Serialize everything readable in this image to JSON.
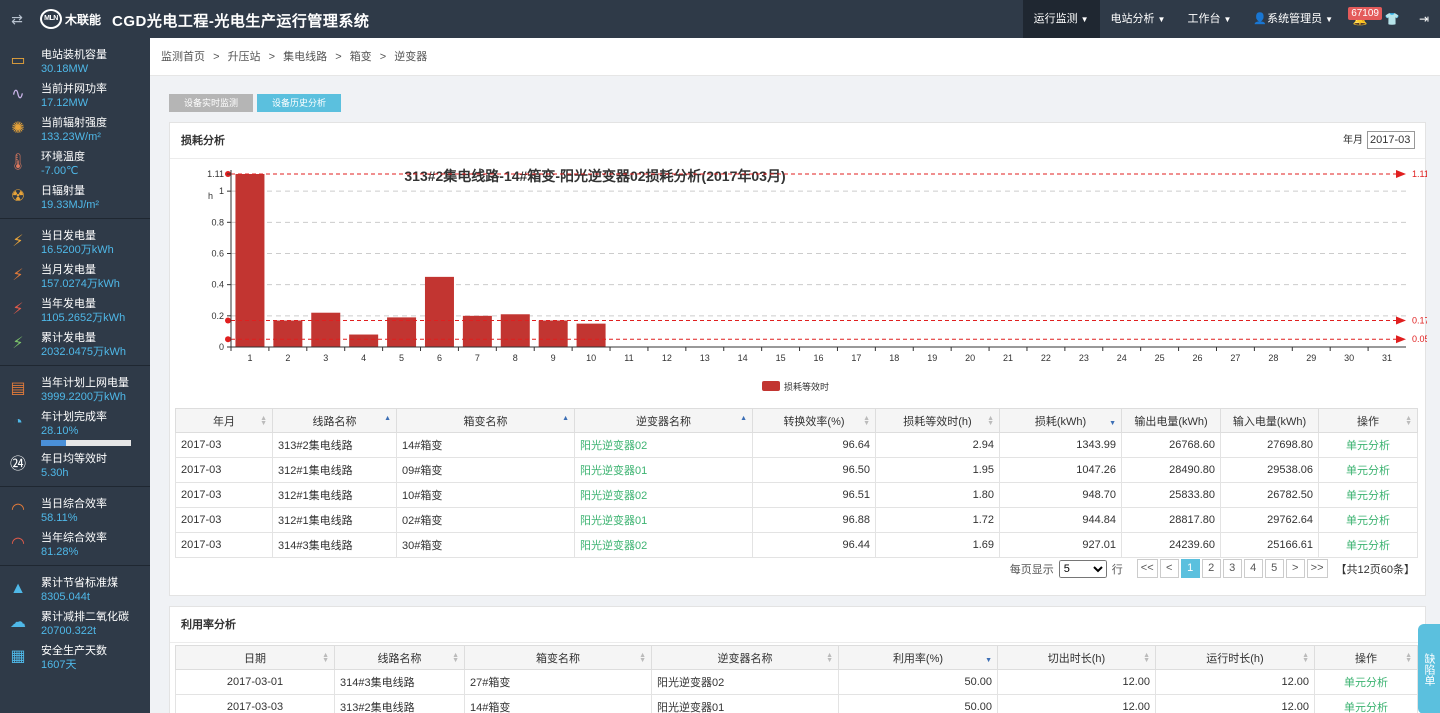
{
  "header": {
    "title": "CGD光电工程-光电生产运行管理系统",
    "logo_mark": "MLN",
    "logo_text": "木联能",
    "nav": [
      {
        "label": "运行监测"
      },
      {
        "label": "电站分析"
      },
      {
        "label": "工作台"
      },
      {
        "label": "系统管理员"
      }
    ],
    "badge": "67109"
  },
  "sidebar": {
    "group1": [
      {
        "label": "电站装机容量",
        "value": "30.18MW",
        "icon": "battery-icon"
      },
      {
        "label": "当前并网功率",
        "value": "17.12MW",
        "icon": "pulse-icon"
      },
      {
        "label": "当前辐射强度",
        "value": "133.23W/m²",
        "icon": "sun-icon"
      },
      {
        "label": "环境温度",
        "value": "-7.00℃",
        "icon": "thermometer-icon"
      },
      {
        "label": "日辐射量",
        "value": "19.33MJ/m²",
        "icon": "radiation-icon"
      }
    ],
    "group2": [
      {
        "label": "当日发电量",
        "value": "16.5200万kWh"
      },
      {
        "label": "当月发电量",
        "value": "157.0274万kWh"
      },
      {
        "label": "当年发电量",
        "value": "1105.2652万kWh"
      },
      {
        "label": "累计发电量",
        "value": "2032.0475万kWh"
      }
    ],
    "group3": [
      {
        "label": "当年计划上网电量",
        "value": "3999.2200万kWh"
      },
      {
        "label": "年计划完成率",
        "value": "28.10%",
        "progress": 0.281
      },
      {
        "label": "年日均等效时",
        "value": "5.30h"
      }
    ],
    "group4": [
      {
        "label": "当日综合效率",
        "value": "58.11%"
      },
      {
        "label": "当年综合效率",
        "value": "81.28%"
      }
    ],
    "group5": [
      {
        "label": "累计节省标准煤",
        "value": "8305.044t"
      },
      {
        "label": "累计减排二氧化碳",
        "value": "20700.322t"
      },
      {
        "label": "安全生产天数",
        "value": "1607天"
      }
    ]
  },
  "breadcrumb": [
    "监测首页",
    ">",
    "升压站",
    ">",
    "集电线路",
    ">",
    "箱变",
    ">",
    "逆变器"
  ],
  "tabs": {
    "realtime": "设备实时监测",
    "history": "设备历史分析"
  },
  "loss_panel": {
    "title": "损耗分析",
    "month_label": "年月",
    "month_value": "2017-03"
  },
  "chart_data": {
    "type": "bar",
    "title": "313#2集电线路-14#箱变-阳光逆变器02损耗分析(2017年03月)",
    "ylabel": "h",
    "categories": [
      "1",
      "2",
      "3",
      "4",
      "5",
      "6",
      "7",
      "8",
      "9",
      "10",
      "11",
      "12",
      "13",
      "14",
      "15",
      "16",
      "17",
      "18",
      "19",
      "20",
      "21",
      "22",
      "23",
      "24",
      "25",
      "26",
      "27",
      "28",
      "29",
      "30",
      "31"
    ],
    "series": [
      {
        "name": "损耗等效时",
        "values": [
          1.11,
          0.17,
          0.22,
          0.08,
          0.19,
          0.45,
          0.2,
          0.21,
          0.17,
          0.15,
          0,
          0,
          0,
          0,
          0,
          0,
          0,
          0,
          0,
          0,
          0,
          0,
          0,
          0,
          0,
          0,
          0,
          0,
          0,
          0,
          0
        ]
      }
    ],
    "yticks": [
      "0",
      "0.2",
      "0.4",
      "0.6",
      "0.8",
      "1",
      "1.11"
    ],
    "ylim": [
      0,
      1.11
    ],
    "markLines": [
      1.11,
      0.17,
      0.05
    ],
    "markLineLabels": [
      "1.11",
      "0.17",
      "0.05"
    ],
    "color": "#c23531",
    "legend": "bottom-center",
    "grid": "horizontal-dashed"
  },
  "loss_table": {
    "columns": [
      "年月",
      "线路名称",
      "箱变名称",
      "逆变器名称",
      "转换效率(%)",
      "损耗等效时(h)",
      "损耗(kWh)",
      "输出电量(kWh)",
      "输入电量(kWh)",
      "操作"
    ],
    "rows": [
      [
        "2017-03",
        "313#2集电线路",
        "14#箱变",
        "阳光逆变器02",
        "96.64",
        "2.94",
        "1343.99",
        "26768.60",
        "27698.80",
        "单元分析"
      ],
      [
        "2017-03",
        "312#1集电线路",
        "09#箱变",
        "阳光逆变器01",
        "96.50",
        "1.95",
        "1047.26",
        "28490.80",
        "29538.06",
        "单元分析"
      ],
      [
        "2017-03",
        "312#1集电线路",
        "10#箱变",
        "阳光逆变器02",
        "96.51",
        "1.80",
        "948.70",
        "25833.80",
        "26782.50",
        "单元分析"
      ],
      [
        "2017-03",
        "312#1集电线路",
        "02#箱变",
        "阳光逆变器01",
        "96.88",
        "1.72",
        "944.84",
        "28817.80",
        "29762.64",
        "单元分析"
      ],
      [
        "2017-03",
        "314#3集电线路",
        "30#箱变",
        "阳光逆变器02",
        "96.44",
        "1.69",
        "927.01",
        "24239.60",
        "25166.61",
        "单元分析"
      ]
    ]
  },
  "pager": {
    "per_page_label": "每页显示",
    "per_page": "5",
    "row_label": "行",
    "buttons": [
      "<<",
      "<",
      "1",
      "2",
      "3",
      "4",
      "5",
      ">",
      ">>"
    ],
    "total": "【共12页60条】"
  },
  "util_panel": {
    "title": "利用率分析",
    "columns": [
      "日期",
      "线路名称",
      "箱变名称",
      "逆变器名称",
      "利用率(%)",
      "切出时长(h)",
      "运行时长(h)",
      "操作"
    ],
    "rows": [
      [
        "2017-03-01",
        "314#3集电线路",
        "27#箱变",
        "阳光逆变器02",
        "50.00",
        "12.00",
        "12.00",
        "单元分析"
      ],
      [
        "2017-03-03",
        "313#2集电线路",
        "14#箱变",
        "阳光逆变器01",
        "50.00",
        "12.00",
        "12.00",
        "单元分析"
      ]
    ]
  },
  "float_tab": "缺陷单"
}
